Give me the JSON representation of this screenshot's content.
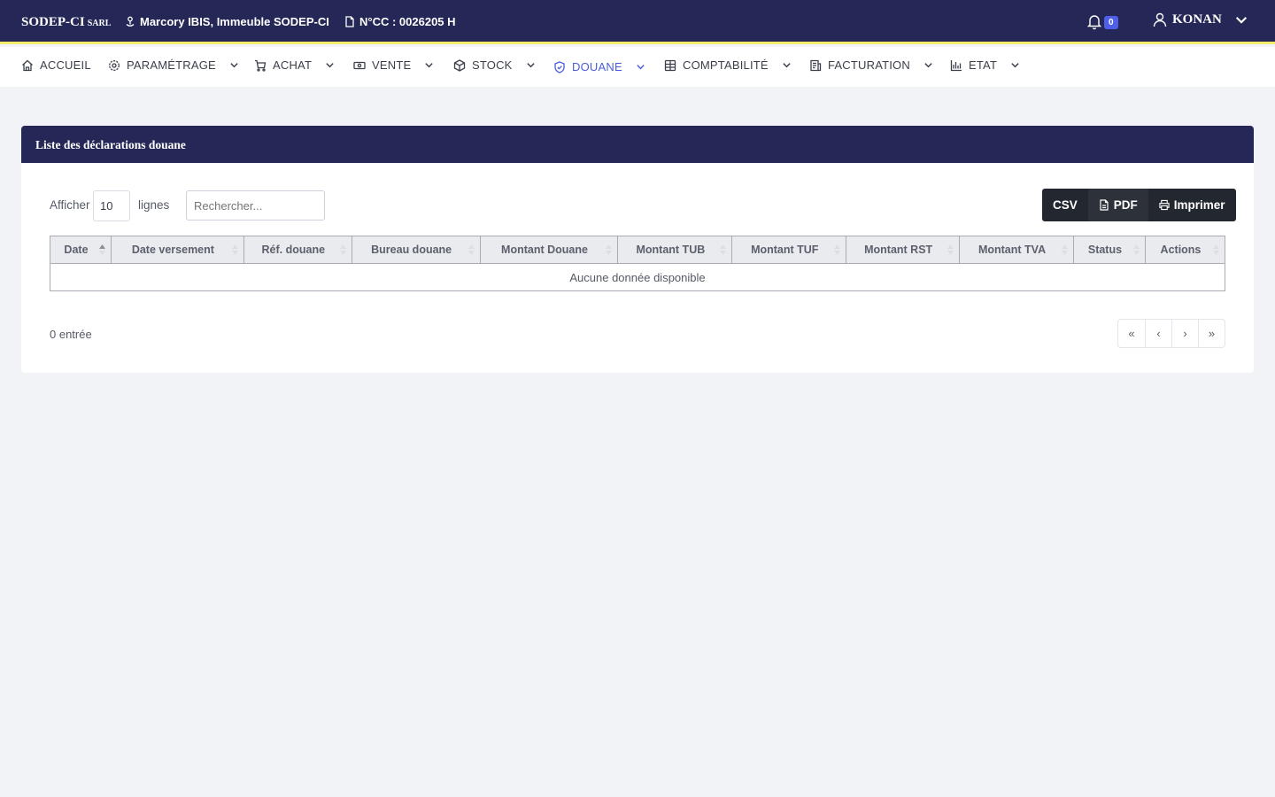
{
  "header": {
    "brand": "SODEP-CI",
    "brand_suffix": "SARL",
    "address": "Marcory IBIS, Immeuble SODEP-CI",
    "ncc": "N°CC : 0026205 H",
    "notifications_count": "0",
    "user_name": "KONAN"
  },
  "nav": {
    "items": [
      {
        "label": "ACCUEIL",
        "icon": "home-icon"
      },
      {
        "label": "PARAMÉTRAGE",
        "icon": "gear-icon"
      },
      {
        "label": "ACHAT",
        "icon": "cart-icon"
      },
      {
        "label": "VENTE",
        "icon": "cash-icon"
      },
      {
        "label": "STOCK",
        "icon": "box-icon"
      },
      {
        "label": "DOUANE",
        "icon": "shield-icon",
        "active": true
      },
      {
        "label": "COMPTABILITÉ",
        "icon": "grid-icon"
      },
      {
        "label": "FACTURATION",
        "icon": "invoice-icon"
      },
      {
        "label": "ETAT",
        "icon": "bar-chart-icon"
      }
    ]
  },
  "card": {
    "title": "Liste des déclarations douane",
    "show_label": "Afficher",
    "page_length": "10",
    "lines_label": "lignes",
    "search_placeholder": "Rechercher...",
    "buttons": {
      "csv": "CSV",
      "pdf": "PDF",
      "print": "Imprimer"
    },
    "columns": [
      "Date",
      "Date versement",
      "Réf. douane",
      "Bureau douane",
      "Montant Douane",
      "Montant TUB",
      "Montant TUF",
      "Montant RST",
      "Montant TVA",
      "Status",
      "Actions"
    ],
    "empty_message": "Aucune donnée disponible",
    "info": "0 entrée",
    "pager": {
      "first": "«",
      "prev": "‹",
      "next": "›",
      "last": "»"
    }
  },
  "colors": {
    "topbar": "#252857",
    "accent_line": "#f2ec6c",
    "active_nav": "#4a5ddb",
    "badge": "#4f5fe8",
    "button_dark": "#23272f"
  }
}
